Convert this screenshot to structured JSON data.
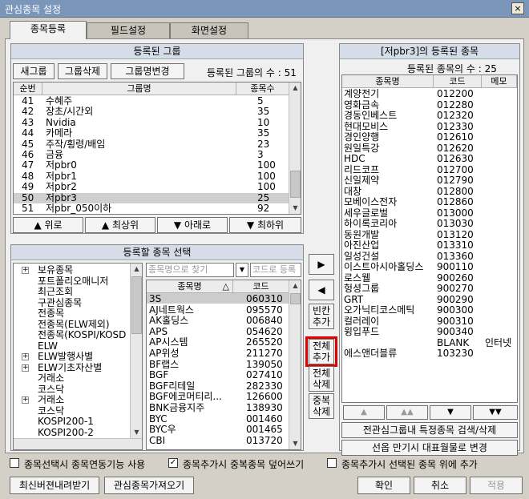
{
  "window": {
    "title": "관심종목 설정",
    "close": "×"
  },
  "tabs": [
    "종목등록",
    "필드설정",
    "화면설정"
  ],
  "groups": {
    "header": "등록된 그룹",
    "btn_new": "새그룹",
    "btn_delete": "그룹삭제",
    "btn_rename": "그룹명변경",
    "count_label": "등록된 그룹의 수 : 51",
    "col_no": "순번",
    "col_name": "그룹명",
    "col_count": "종목수",
    "rows": [
      [
        "41",
        "수혜주",
        "5"
      ],
      [
        "42",
        "장초/시간외",
        "35"
      ],
      [
        "43",
        "Nvidia",
        "10"
      ],
      [
        "44",
        "카메라",
        "35"
      ],
      [
        "45",
        "주작/횡령/배임",
        "23"
      ],
      [
        "46",
        "금융",
        "3"
      ],
      [
        "47",
        "저pbr0",
        "100"
      ],
      [
        "48",
        "저pbr1",
        "100"
      ],
      [
        "49",
        "저pbr2",
        "100"
      ],
      [
        "50",
        "저pbr3",
        "25"
      ],
      [
        "51",
        "저pbr_050이하",
        "92"
      ]
    ],
    "btn_up": "▲ 위로",
    "btn_top": "▲ 최상위",
    "btn_down": "▼ 아래로",
    "btn_bottom": "▼ 최하위"
  },
  "select": {
    "header": "등록할 종목 선택",
    "tree": [
      "보유종목",
      "포트폴리오매니저",
      "최근조회",
      "구관심종목",
      "전종목",
      "전종목(ELW제외)",
      "전종목(KOSPI/KOSD",
      "ELW",
      "ELW발행사별",
      "ELW기초자산별",
      "거래소",
      "코스닥",
      "거래소",
      "코스닥",
      "KOSPI200-1",
      "KOSPI200-2"
    ],
    "name_placeholder": "종목명으로 찾기",
    "code_placeholder": "코드로 등록",
    "col_name": "종목명",
    "col_sort": "△",
    "col_code": "코드",
    "stocks": [
      [
        "3S",
        "060310"
      ],
      [
        "AJ네트웍스",
        "095570"
      ],
      [
        "AK홀딩스",
        "006840"
      ],
      [
        "APS",
        "054620"
      ],
      [
        "AP시스템",
        "265520"
      ],
      [
        "AP위성",
        "211270"
      ],
      [
        "BF랩스",
        "139050"
      ],
      [
        "BGF",
        "027410"
      ],
      [
        "BGF리테일",
        "282330"
      ],
      [
        "BGF에코머티리...",
        "126600"
      ],
      [
        "BNK금융지주",
        "138930"
      ],
      [
        "BYC",
        "001460"
      ],
      [
        "BYC우",
        "001465"
      ],
      [
        "CBI",
        "013720"
      ]
    ]
  },
  "middle": {
    "add": "▶",
    "remove": "◀",
    "blank_add": "빈칸\n추가",
    "all_add": "전체\n추가",
    "all_del": "전체\n삭제",
    "dup_del": "중복\n삭제"
  },
  "registered": {
    "header": "[저pbr3]의 등록된 종목",
    "count_label": "등록된 종목의 수 : 25",
    "col_name": "종목명",
    "col_code": "코드",
    "col_memo": "메모",
    "rows": [
      [
        "계양전기",
        "012200",
        ""
      ],
      [
        "영화금속",
        "012280",
        ""
      ],
      [
        "경동인베스트",
        "012320",
        ""
      ],
      [
        "현대모비스",
        "012330",
        ""
      ],
      [
        "경인양행",
        "012610",
        ""
      ],
      [
        "원일특강",
        "012620",
        ""
      ],
      [
        "HDC",
        "012630",
        ""
      ],
      [
        "리드코프",
        "012700",
        ""
      ],
      [
        "신일제약",
        "012790",
        ""
      ],
      [
        "대창",
        "012800",
        ""
      ],
      [
        "모베이스전자",
        "012860",
        ""
      ],
      [
        "세우글로벌",
        "013000",
        ""
      ],
      [
        "하이록코리아",
        "013030",
        ""
      ],
      [
        "동원개발",
        "013120",
        ""
      ],
      [
        "아진산업",
        "013310",
        ""
      ],
      [
        "일성건설",
        "013360",
        ""
      ],
      [
        "이스트아시아홀딩스",
        "900110",
        ""
      ],
      [
        "로스웰",
        "900260",
        ""
      ],
      [
        "헝셩그룹",
        "900270",
        ""
      ],
      [
        "GRT",
        "900290",
        ""
      ],
      [
        "오가닉티코스메틱",
        "900300",
        ""
      ],
      [
        "컬러레이",
        "900310",
        ""
      ],
      [
        "윙입푸드",
        "900340",
        ""
      ],
      [
        "",
        "BLANK",
        "인터넷"
      ],
      [
        "에스앤더블류",
        "103230",
        ""
      ]
    ],
    "nav_top": "▲",
    "nav_up": "▲▲",
    "nav_down": "▼",
    "nav_bottom": "▼▼",
    "btn_search": "전관심그룹내 특정종목 검색/삭제",
    "btn_maturity": "선옵 만기시 대표월물로 변경"
  },
  "options": {
    "opt1": "종목선택시 종목연동기능 사용",
    "opt2": "종목추가시 중복종목 덮어쓰기",
    "opt2_mark": "✓",
    "opt3": "종목추가시 선택된 종목 위에 추가"
  },
  "bottom": {
    "btn_download": "최신버젼내려받기",
    "btn_import": "관심종목가져오기",
    "btn_ok": "확인",
    "btn_cancel": "취소",
    "btn_apply": "적용"
  }
}
